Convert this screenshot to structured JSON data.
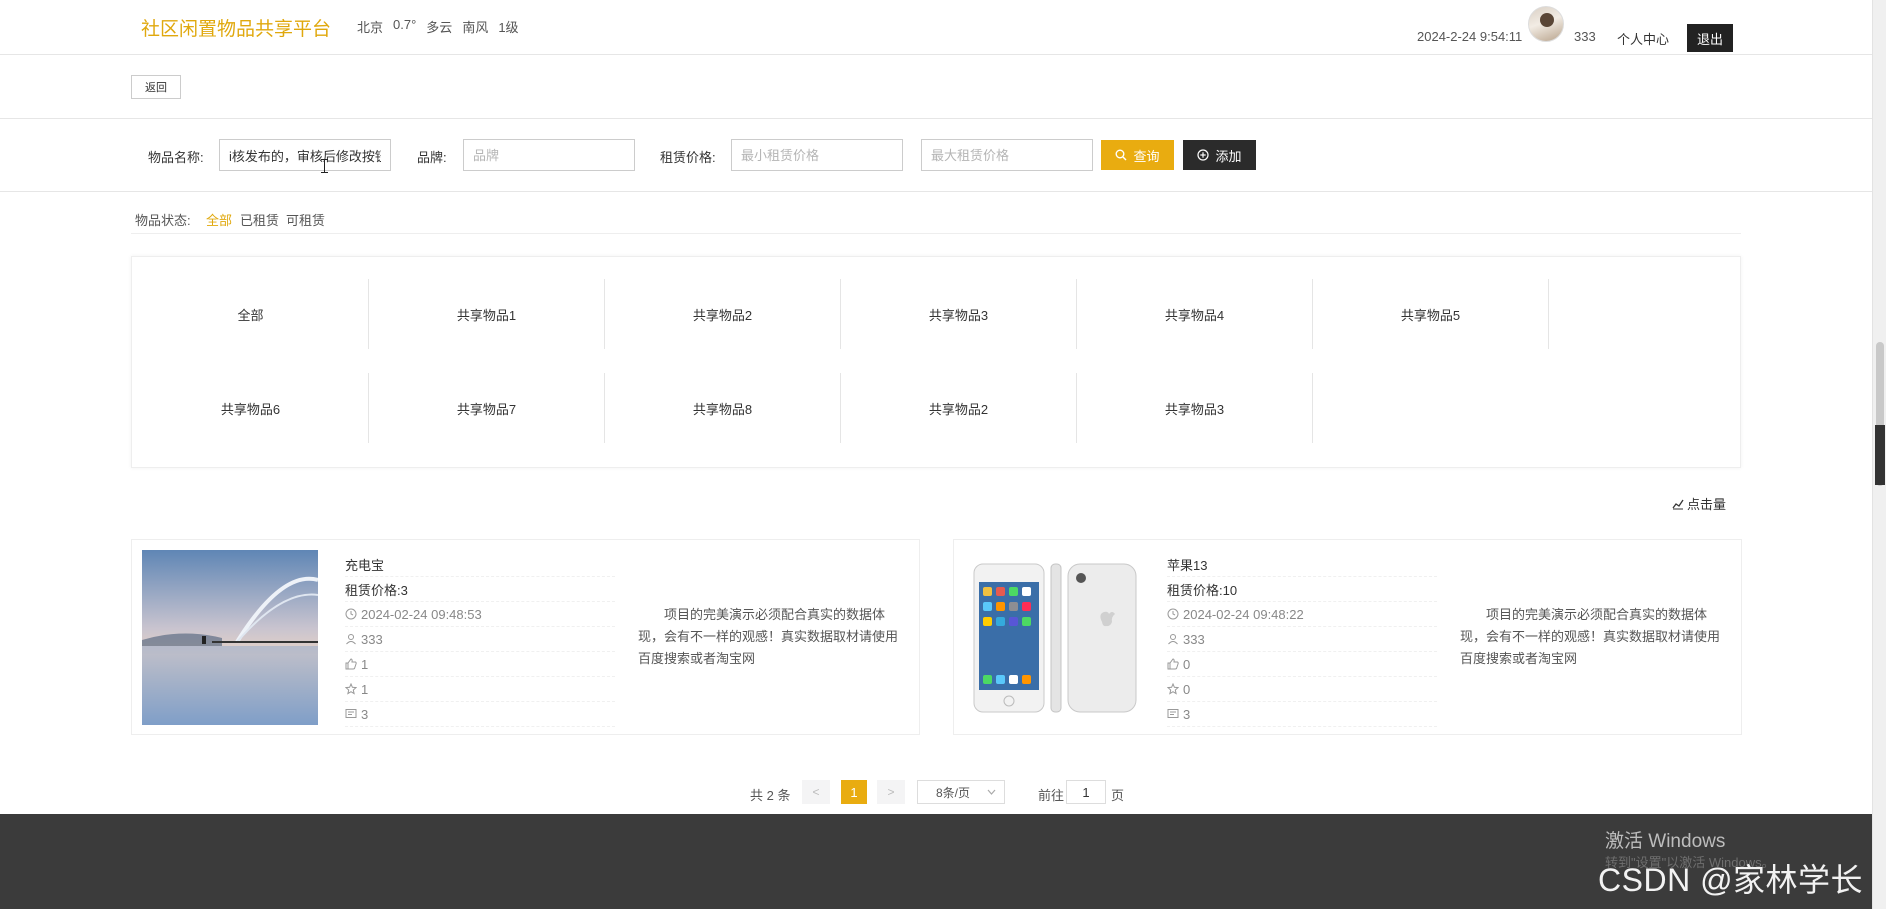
{
  "header": {
    "site_title": "社区闲置物品共享平台",
    "weather": {
      "city": "北京",
      "temp": "0.7°",
      "condition": "多云",
      "wind": "南风",
      "level": "1级"
    },
    "datetime": "2024-2-24 9:54:11",
    "username": "333",
    "personal_center": "个人中心",
    "logout": "退出"
  },
  "back_button": "返回",
  "search": {
    "name_label": "物品名称:",
    "name_value": "i核发布的，审核后修改按钮",
    "brand_label": "品牌:",
    "brand_placeholder": "品牌",
    "price_label": "租赁价格:",
    "min_price_placeholder": "最小租赁价格",
    "max_price_placeholder": "最大租赁价格",
    "query_button": "查询",
    "add_button": "添加"
  },
  "status_filter": {
    "label": "物品状态:",
    "options": [
      "全部",
      "已租赁",
      "可租赁"
    ],
    "active": "全部"
  },
  "categories": [
    "全部",
    "共享物品1",
    "共享物品2",
    "共享物品3",
    "共享物品4",
    "共享物品5",
    "共享物品6",
    "共享物品7",
    "共享物品8",
    "共享物品2",
    "共享物品3"
  ],
  "sort_link": "点击量",
  "items": [
    {
      "name": "充电宝",
      "price": "租赁价格:3",
      "time": "2024-02-24 09:48:53",
      "user": "333",
      "likes": "1",
      "favorites": "1",
      "comments": "3",
      "description": "项目的完美演示必须配合真实的数据体现，会有不一样的观感！真实数据取材请使用百度搜索或者淘宝网"
    },
    {
      "name": "苹果13",
      "price": "租赁价格:10",
      "time": "2024-02-24 09:48:22",
      "user": "333",
      "likes": "0",
      "favorites": "0",
      "comments": "3",
      "description": "项目的完美演示必须配合真实的数据体现，会有不一样的观感！真实数据取材请使用百度搜索或者淘宝网"
    }
  ],
  "pagination": {
    "total": "共 2 条",
    "prev": "<",
    "current_page": "1",
    "next": ">",
    "page_size": "8条/页",
    "goto_label": "前往",
    "goto_value": "1",
    "page_word": "页"
  },
  "overlay": {
    "windows_activate": "激活 Windows",
    "windows_sub": "转到\"设置\"以激活 Windows。",
    "watermark": "CSDN @家林学长"
  },
  "colors": {
    "accent": "#e9ac10",
    "dark": "#2b2b2b",
    "footer": "#3b3b3b"
  }
}
